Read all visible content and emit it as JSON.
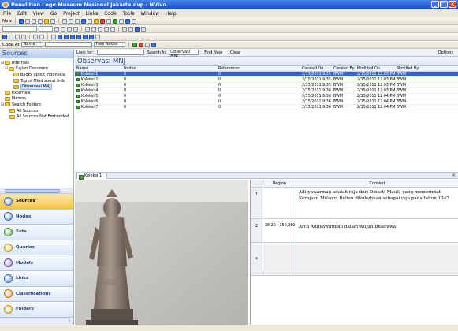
{
  "window": {
    "title": "Penelitian Logo Museum Nasional Jakarta.nvp - NVivo",
    "controls": [
      "_",
      "□",
      "×"
    ]
  },
  "menu": [
    "File",
    "Edit",
    "View",
    "Go",
    "Project",
    "Links",
    "Code",
    "Tools",
    "Window",
    "Help"
  ],
  "toolbar": {
    "new_label": "New",
    "code_at_label": "Code At",
    "code_at_value": "Name",
    "free_nodes_label": "Free Nodes"
  },
  "sources_panel": {
    "title": "Sources",
    "tree": [
      {
        "label": "Internals",
        "level": 0,
        "expander": "⊟"
      },
      {
        "label": "Kajian Dokumen",
        "level": 1,
        "expander": "⊟"
      },
      {
        "label": "Books about Indonesia",
        "level": 2,
        "expander": ""
      },
      {
        "label": "Top of Mind about Indo",
        "level": 2,
        "expander": ""
      },
      {
        "label": "Observasi MNJ",
        "level": 2,
        "expander": "",
        "selected": true
      },
      {
        "label": "Externals",
        "level": 0,
        "expander": ""
      },
      {
        "label": "Memos",
        "level": 0,
        "expander": ""
      },
      {
        "label": "Search Folders",
        "level": 0,
        "expander": "⊟"
      },
      {
        "label": "All Sources",
        "level": 1,
        "expander": ""
      },
      {
        "label": "All Sources Not Embedded",
        "level": 1,
        "expander": ""
      }
    ],
    "nav_buttons": [
      {
        "label": "Sources",
        "icon": "sources-icon",
        "active": true
      },
      {
        "label": "Nodes",
        "icon": "nodes-icon"
      },
      {
        "label": "Sets",
        "icon": "sets-icon"
      },
      {
        "label": "Queries",
        "icon": "queries-icon"
      },
      {
        "label": "Models",
        "icon": "models-icon"
      },
      {
        "label": "Links",
        "icon": "links-icon"
      },
      {
        "label": "Classifications",
        "icon": "classifications-icon"
      },
      {
        "label": "Folders",
        "icon": "folders-icon"
      }
    ]
  },
  "find_bar": {
    "look_for_label": "Look for:",
    "search_in_label": "Search In",
    "search_in_value": "Observasi MNJ",
    "find_now_label": "Find Now",
    "clear_label": "Clear",
    "options_label": "Options"
  },
  "list": {
    "title": "Observasi MNJ",
    "columns": [
      "Name",
      "Nodes",
      "References",
      "Created On",
      "Created By",
      "Modified On",
      "Modified By"
    ],
    "rows": [
      [
        "Koleksi 1",
        "0",
        "0",
        "2/15/2011 9:35",
        "BWM",
        "2/15/2011 12:03 PM",
        "BWM"
      ],
      [
        "Koleksi 2",
        "0",
        "0",
        "2/15/2011 9:35",
        "BWM",
        "2/15/2011 12:03 PM",
        "BWM"
      ],
      [
        "Koleksi 3",
        "0",
        "0",
        "2/15/2011 9:35",
        "BWM",
        "2/15/2011 12:03 PM",
        "BWM"
      ],
      [
        "Koleksi 4",
        "0",
        "0",
        "2/15/2011 9:36",
        "BWM",
        "2/15/2011 12:03 PM",
        "BWM"
      ],
      [
        "Koleksi 5",
        "0",
        "0",
        "2/15/2011 9:36",
        "BWM",
        "2/15/2011 12:04 PM",
        "BWM"
      ],
      [
        "Koleksi 6",
        "0",
        "0",
        "2/15/2011 9:36",
        "BWM",
        "2/15/2011 12:04 PM",
        "BWM"
      ],
      [
        "Koleksi 7",
        "0",
        "0",
        "2/15/2011 9:36",
        "BWM",
        "2/15/2011 12:04 PM",
        "BWM"
      ]
    ]
  },
  "detail": {
    "tab_label": "Koleksi 1",
    "close": "×",
    "region_header": "Region",
    "content_header": "Content",
    "regions": [
      {
        "num": "1",
        "region": "",
        "content": "Adityawarman adalah raja dari Dinasti Mauli, yang memerintah Kerajaan Melayu. Beliau dikukuhkan sebagai raja pada tahun 1347"
      },
      {
        "num": "2",
        "region": "38,20 - 150,380",
        "content": "Arca Adityawarman dalam wujud Bhairawa."
      },
      {
        "num": "*",
        "region": "",
        "content": ""
      }
    ]
  }
}
